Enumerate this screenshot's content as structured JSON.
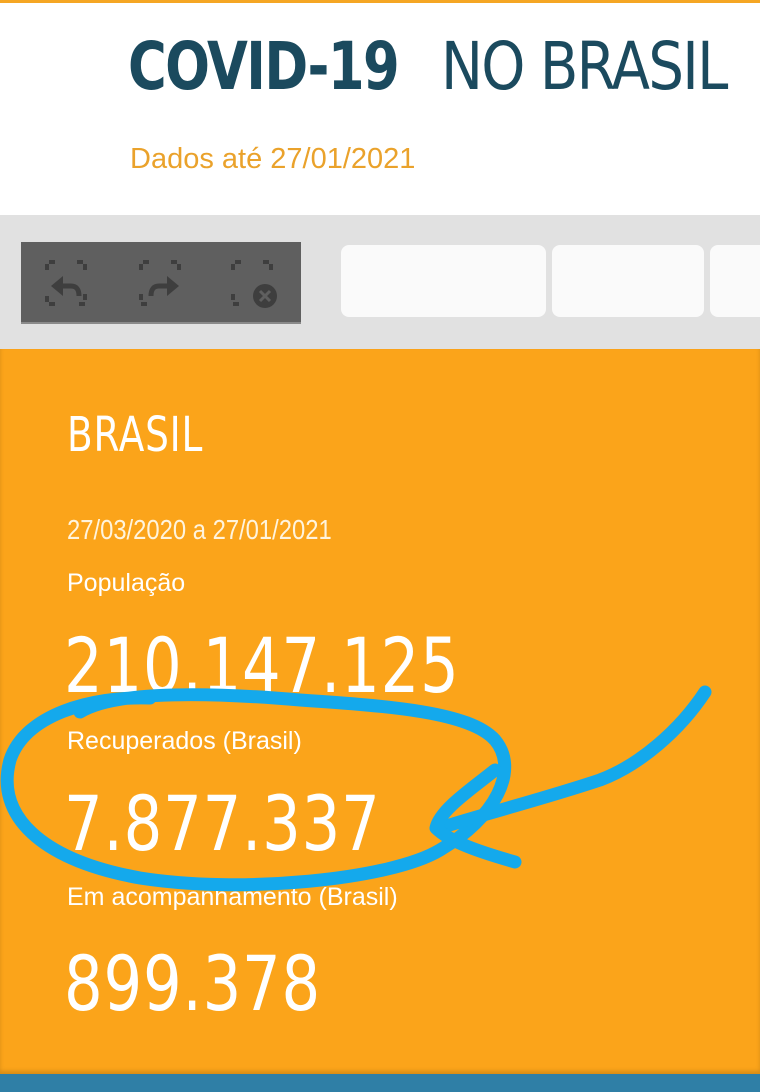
{
  "header": {
    "title_strong": "COVID-19",
    "title_light": "NO BRASIL",
    "updated": "Dados até 27/01/2021"
  },
  "toolbar": {
    "tools": [
      {
        "icon": "selection-undo-icon"
      },
      {
        "icon": "selection-redo-icon"
      },
      {
        "icon": "selection-clear-icon"
      }
    ]
  },
  "card": {
    "region": "BRASIL",
    "range": "27/03/2020 a 27/01/2021",
    "stats": [
      {
        "label": "População",
        "value": "210.147.125"
      },
      {
        "label": "Recuperados (Brasil)",
        "value": "7.877.337"
      },
      {
        "label": "Em acompanhamento (Brasil)",
        "value": "899.378"
      }
    ]
  },
  "colors": {
    "title": "#1b4a5e",
    "accent": "#eaa22b",
    "card": "#fba41a",
    "annotation": "#14a9ec"
  }
}
